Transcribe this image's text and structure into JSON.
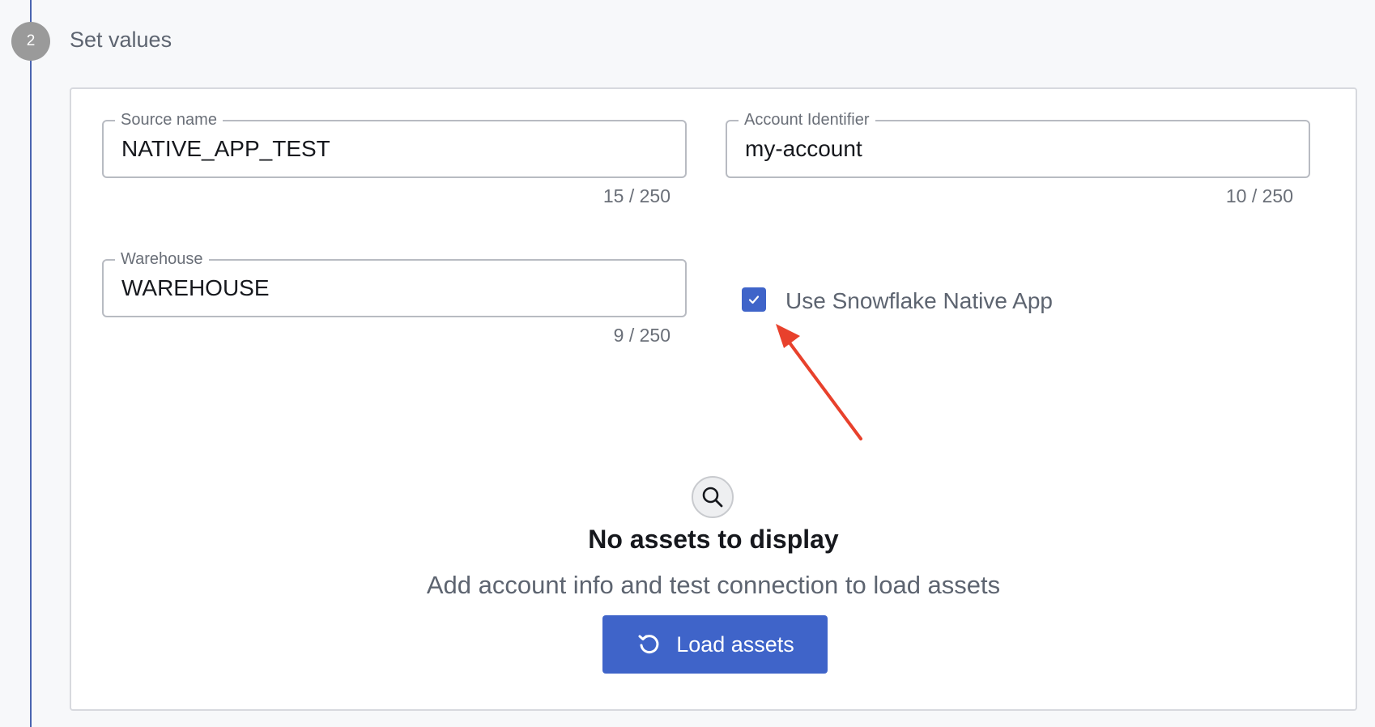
{
  "step": {
    "number": "2",
    "title": "Set values"
  },
  "form": {
    "source_name": {
      "label": "Source name",
      "value": "NATIVE_APP_TEST",
      "counter": "15 / 250"
    },
    "account_identifier": {
      "label": "Account Identifier",
      "value": "my-account",
      "counter": "10 / 250"
    },
    "warehouse": {
      "label": "Warehouse",
      "value": "WAREHOUSE",
      "counter": "9 / 250"
    },
    "native_app_checkbox": {
      "label": "Use Snowflake Native App",
      "checked": true
    }
  },
  "empty_state": {
    "icon": "search-icon",
    "title": "No assets to display",
    "subtitle": "Add account info and test connection to load assets",
    "button_label": "Load assets",
    "button_icon": "refresh-icon"
  },
  "colors": {
    "accent": "#3f64c9",
    "stepper_line": "#4a64b0",
    "annotation_arrow": "#e8412c"
  }
}
